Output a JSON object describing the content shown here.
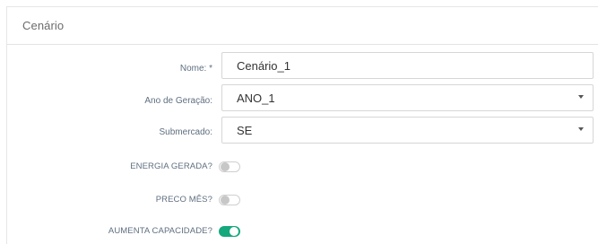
{
  "panel": {
    "title": "Cenário"
  },
  "form": {
    "nome": {
      "label": "Nome: *",
      "value": "Cenário_1"
    },
    "ano_geracao": {
      "label": "Ano de Geração:",
      "value": "ANO_1"
    },
    "submercado": {
      "label": "Submercado:",
      "value": "SE"
    },
    "energia_gerada": {
      "label": "ENERGIA GERADA?",
      "checked": false
    },
    "preco_mes": {
      "label": "PRECO MÊS?",
      "checked": false
    },
    "aumenta_capacidade": {
      "label": "AUMENTA CAPACIDADE?",
      "checked": true
    }
  },
  "colors": {
    "toggle_on": "#14a87c",
    "toggle_off_knob": "#c7c7c7",
    "label_text": "#5f6f80"
  }
}
